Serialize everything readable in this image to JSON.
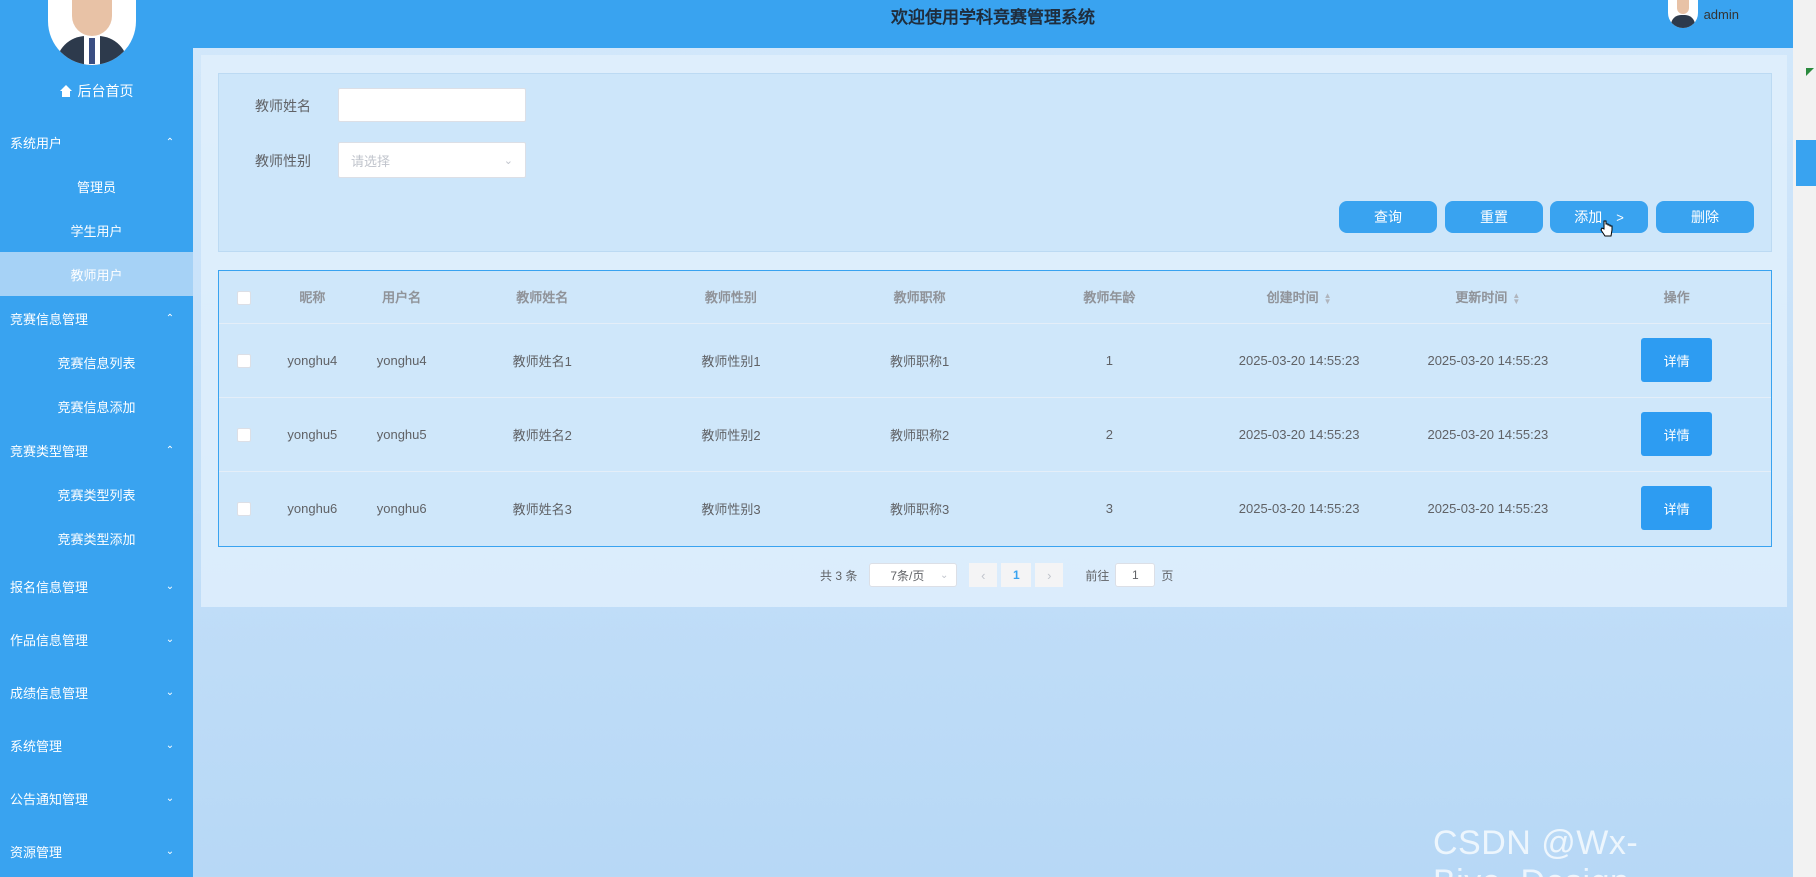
{
  "header": {
    "title": "欢迎使用学科竞赛管理系统",
    "username": "admin"
  },
  "sidebar": {
    "home_label": "后台首页",
    "menu": [
      {
        "label": "系统用户",
        "chevron": "⌃"
      },
      {
        "label": "管理员"
      },
      {
        "label": "学生用户"
      },
      {
        "label": "教师用户"
      },
      {
        "label": "竞赛信息管理",
        "chevron": "⌃"
      },
      {
        "label": "竞赛信息列表"
      },
      {
        "label": "竞赛信息添加"
      },
      {
        "label": "竞赛类型管理",
        "chevron": "⌃"
      },
      {
        "label": "竞赛类型列表"
      },
      {
        "label": "竞赛类型添加"
      },
      {
        "label": "报名信息管理",
        "chevron": "⌄"
      },
      {
        "label": "作品信息管理",
        "chevron": "⌄"
      },
      {
        "label": "成绩信息管理",
        "chevron": "⌄"
      },
      {
        "label": "系统管理",
        "chevron": "⌄"
      },
      {
        "label": "公告通知管理",
        "chevron": "⌄"
      },
      {
        "label": "资源管理",
        "chevron": "⌄"
      }
    ]
  },
  "search": {
    "name_label": "教师姓名",
    "name_value": "",
    "gender_label": "教师性别",
    "gender_placeholder": "请选择"
  },
  "actions": {
    "query": "查询",
    "reset": "重置",
    "add": "添加",
    "add_chevron": ">",
    "delete": "删除"
  },
  "table": {
    "headers": {
      "nickname": "昵称",
      "username": "用户名",
      "teacher_name": "教师姓名",
      "teacher_gender": "教师性别",
      "teacher_title": "教师职称",
      "teacher_age": "教师年龄",
      "created": "创建时间",
      "updated": "更新时间",
      "ops": "操作"
    },
    "rows": [
      {
        "nickname": "yonghu4",
        "username": "yonghu4",
        "teacher_name": "教师姓名1",
        "teacher_gender": "教师性别1",
        "teacher_title": "教师职称1",
        "teacher_age": "1",
        "created": "2025-03-20 14:55:23",
        "updated": "2025-03-20 14:55:23",
        "detail": "详情"
      },
      {
        "nickname": "yonghu5",
        "username": "yonghu5",
        "teacher_name": "教师姓名2",
        "teacher_gender": "教师性别2",
        "teacher_title": "教师职称2",
        "teacher_age": "2",
        "created": "2025-03-20 14:55:23",
        "updated": "2025-03-20 14:55:23",
        "detail": "详情"
      },
      {
        "nickname": "yonghu6",
        "username": "yonghu6",
        "teacher_name": "教师姓名3",
        "teacher_gender": "教师性别3",
        "teacher_title": "教师职称3",
        "teacher_age": "3",
        "created": "2025-03-20 14:55:23",
        "updated": "2025-03-20 14:55:23",
        "detail": "详情"
      }
    ]
  },
  "pagination": {
    "total": "共 3 条",
    "page_size": "7条/页",
    "current_page": "1",
    "goto_label": "前往",
    "goto_value": "1",
    "page_unit": "页"
  },
  "watermark": "CSDN @Wx-Biye_Design",
  "colors": {
    "primary": "#39a3f0",
    "active_menu": "#a6d2f6"
  }
}
